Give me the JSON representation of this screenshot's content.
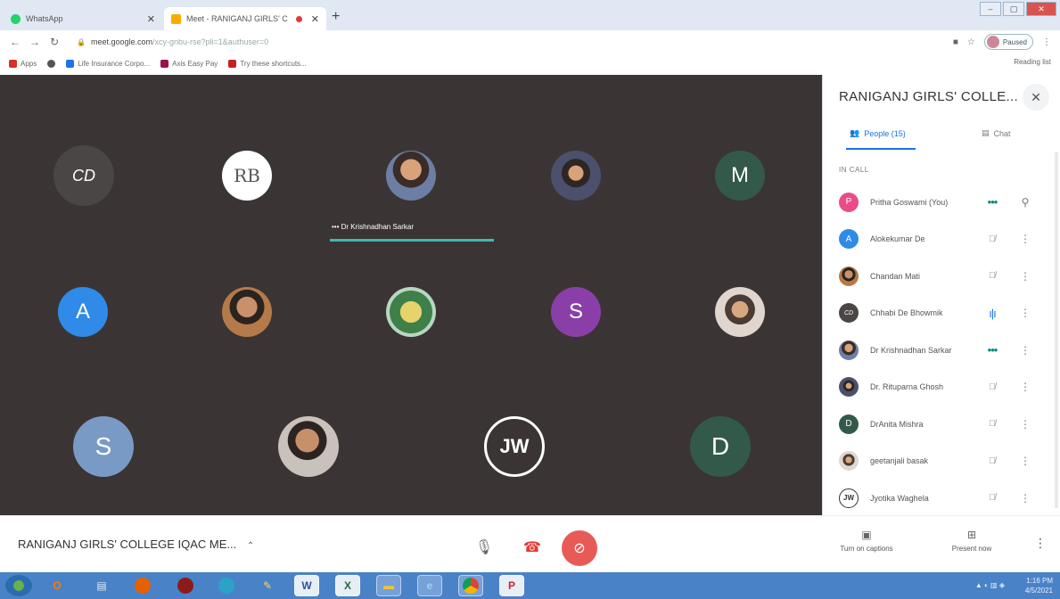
{
  "browser": {
    "tabs": [
      {
        "title": "WhatsApp",
        "active": false,
        "favicon_color": "#25d366"
      },
      {
        "title": "Meet - RANIGANJ GIRLS' C",
        "active": true,
        "favicon_color": "#f9ab00"
      }
    ],
    "new_tab": "+",
    "url_main": "meet.google.com",
    "url_rest": "/xcy-gnbu-rse?pli=1&authuser=0",
    "profile_status": "Paused",
    "bookmarks": [
      {
        "label": "Apps",
        "color": "#d93025"
      },
      {
        "label": "",
        "color": "#555"
      },
      {
        "label": "Life Insurance Corpo...",
        "color": "#1a73e8"
      },
      {
        "label": "Axis Easy Pay",
        "color": "#97144d"
      },
      {
        "label": "Try these shortcuts...",
        "color": "#c5221f"
      }
    ],
    "reading_list": "Reading list"
  },
  "stage": {
    "active_speaker_label": "Dr Krishnadhan Sarkar",
    "active_speaker_color": "#3fb8b0",
    "tiles": [
      {
        "initial": "CD",
        "color": "#4a4645",
        "kind": "logo"
      },
      {
        "initial": "RB",
        "color": "#ffffff",
        "kind": "monogram"
      },
      {
        "initial": "",
        "color": "#6d7ea4",
        "kind": "photo"
      },
      {
        "initial": "",
        "color": "#2c2420",
        "kind": "photo"
      },
      {
        "initial": "M",
        "color": "#33594a",
        "kind": "letter"
      },
      {
        "initial": "A",
        "color": "#2f8ae8",
        "kind": "letter"
      },
      {
        "initial": "",
        "color": "#b57a4a",
        "kind": "photo"
      },
      {
        "initial": "",
        "color": "#3f7f4a",
        "kind": "seal"
      },
      {
        "initial": "S",
        "color": "#8a3fa8",
        "kind": "letter"
      },
      {
        "initial": "",
        "color": "#e0d6cf",
        "kind": "photo"
      },
      {
        "initial": "S",
        "color": "#7a9ac6",
        "kind": "letter"
      },
      {
        "initial": "",
        "color": "#4c4f6d",
        "kind": "photo"
      },
      {
        "initial": "JW",
        "color": "#3a3534",
        "kind": "ring"
      },
      {
        "initial": "D",
        "color": "#33594a",
        "kind": "letter"
      }
    ]
  },
  "panel": {
    "title": "RANIGANJ GIRLS' COLLE...",
    "tab_people": "People (15)",
    "tab_chat": "Chat",
    "section": "IN CALL",
    "participants": [
      {
        "name": "Pritha Goswami (You)",
        "initial": "P",
        "color": "#e94c89",
        "status": "dots",
        "action": "pin"
      },
      {
        "name": "Alokekumar De",
        "initial": "A",
        "color": "#2f8ae8",
        "status": "muted",
        "action": "more"
      },
      {
        "name": "Chandan Mati",
        "initial": "",
        "color": "#b57a4a",
        "status": "muted",
        "action": "more"
      },
      {
        "name": "Chhabi De Bhowmik",
        "initial": "CD",
        "color": "#4a4645",
        "status": "speaking",
        "action": "more"
      },
      {
        "name": "Dr Krishnadhan Sarkar",
        "initial": "",
        "color": "#6d7ea4",
        "status": "dots",
        "action": "more"
      },
      {
        "name": "Dr. Rituparna Ghosh",
        "initial": "",
        "color": "#2c2420",
        "status": "muted",
        "action": "more"
      },
      {
        "name": "DrAnita Mishra",
        "initial": "D",
        "color": "#33594a",
        "status": "muted",
        "action": "more"
      },
      {
        "name": "geetanjali basak",
        "initial": "",
        "color": "#c58a6a",
        "status": "muted",
        "action": "more"
      },
      {
        "name": "Jyotika Waghela",
        "initial": "JW",
        "color": "#ffffff",
        "status": "muted",
        "action": "more"
      }
    ]
  },
  "bottom": {
    "meeting_name": "RANIGANJ GIRLS' COLLEGE IQAC ME...",
    "captions_label": "Turn on captions",
    "present_label": "Present now",
    "hangup_color": "#e53935",
    "camera_off_color": "#e85a55"
  },
  "taskbar": {
    "apps": [
      "start-orb-icon",
      "office-icon",
      "notepad-icon",
      "firefox-icon",
      "media-icon",
      "edge-icon",
      "paint-icon",
      "word-icon",
      "excel-icon",
      "folder-icon",
      "ie-icon",
      "chrome-icon",
      "pdf-icon"
    ],
    "time": "1:16 PM",
    "date": "4/5/2021"
  }
}
